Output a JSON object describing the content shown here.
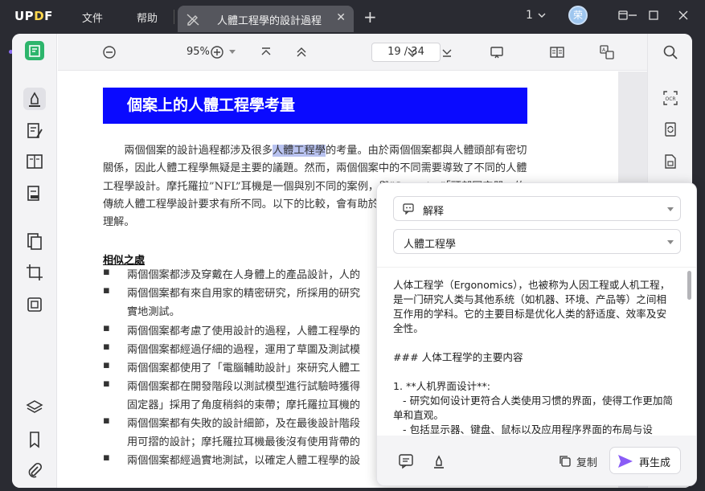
{
  "app": {
    "logo": "UPDF",
    "menu": {
      "file": "文件",
      "help": "帮助"
    },
    "tab": {
      "title": "人體工程學的設計過程"
    },
    "page_count_badge": "1",
    "avatar_letter": "荣"
  },
  "toolbar": {
    "zoom": "95%",
    "page_indicator": "19 / 34"
  },
  "document": {
    "banner": "個案上的人體工程學考量",
    "paragraph_before": "兩個個案的設計過程都涉及很多",
    "paragraph_highlight": "人體工程學",
    "paragraph_after": "的考量。由於兩個個案都與人體頭部有密切關係，因此人體工程學無疑是主要的議題。然而，兩個個案中的不同需要導致了不同的人體工程學設計。摩托羅拉”NFL”耳機是一個與別不同的案例，與”Serenity”「頭部固定器」的傳統人體工程學設計要求有所不同。以下的比較，會有助於更進一步了解各種人體工程學的理解。",
    "section_title": "相似之處",
    "bullets": [
      "兩個個案都涉及穿戴在人身體上的產品設計，人的",
      "兩個個案都有來自用家的精密研究，所採用的研究",
      "實地測試。",
      "兩個個案都考慮了使用設計的過程，人體工程學的",
      "兩個個案都經過仔細的過程，運用了草圖及測試模",
      "兩個個案都使用了「電腦輔助設計」來研究人體工",
      "兩個個案都在開發階段以測試模型進行試驗時獲得",
      "固定器」採用了角度稍斜的束帶；摩托羅拉耳機的",
      "兩個個案都有失敗的設計細節，及在最後設計階段",
      "用可摺的設計；摩托羅拉耳機最後沒有使用背帶的",
      "兩個個案都經過實地測試，以確定人體工程學的設"
    ]
  },
  "ai": {
    "mode": "解释",
    "query": "人體工程學",
    "response": "人体工程学（Ergonomics），也被称为人因工程或人机工程，是一门研究人类与其他系统（如机器、环境、产品等）之间相互作用的学科。它的主要目标是优化人类的舒适度、效率及安全性。\n\n### 人体工程学的主要内容\n\n1. **人机界面设计**:\n   - 研究如何设计更符合人类使用习惯的界面，使得工作更加简单和直观。\n   - 包括显示器、键盘、鼠标以及应用程序界面的布局与设",
    "copy_label": "复制",
    "regenerate_label": "再生成"
  }
}
